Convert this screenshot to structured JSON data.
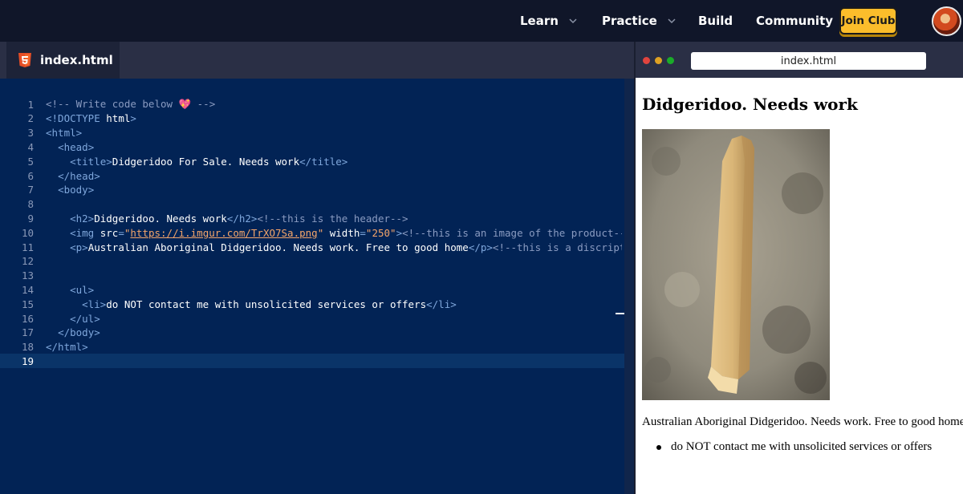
{
  "nav": {
    "items": [
      {
        "label": "Learn",
        "has_dropdown": true
      },
      {
        "label": "Practice",
        "has_dropdown": true
      },
      {
        "label": "Build",
        "has_dropdown": false
      },
      {
        "label": "Community",
        "has_dropdown": false
      }
    ],
    "join_label": "Join Club",
    "avatar_icon": "user-avatar"
  },
  "editor": {
    "tab": {
      "icon": "html5-icon",
      "label": "index.html"
    },
    "active_line": 19,
    "lines": [
      {
        "n": "1",
        "tokens": [
          [
            "cmt",
            "<!-- Write code below 💖 -->"
          ]
        ]
      },
      {
        "n": "2",
        "tokens": [
          [
            "tag",
            "<!DOCTYPE "
          ],
          [
            "txt",
            "html"
          ],
          [
            "tag",
            ">"
          ]
        ]
      },
      {
        "n": "3",
        "tokens": [
          [
            "tag",
            "<html>"
          ]
        ]
      },
      {
        "n": "4",
        "tokens": [
          [
            "txt",
            "  "
          ],
          [
            "tag",
            "<head>"
          ]
        ]
      },
      {
        "n": "5",
        "tokens": [
          [
            "txt",
            "    "
          ],
          [
            "tag",
            "<title>"
          ],
          [
            "txt",
            "Didgeridoo For Sale. Needs work"
          ],
          [
            "tag",
            "</title>"
          ]
        ]
      },
      {
        "n": "6",
        "tokens": [
          [
            "txt",
            "  "
          ],
          [
            "tag",
            "</head>"
          ]
        ]
      },
      {
        "n": "7",
        "tokens": [
          [
            "txt",
            "  "
          ],
          [
            "tag",
            "<body>"
          ]
        ]
      },
      {
        "n": "8",
        "tokens": [
          [
            "txt",
            ""
          ]
        ]
      },
      {
        "n": "9",
        "tokens": [
          [
            "txt",
            "    "
          ],
          [
            "tag",
            "<h2>"
          ],
          [
            "txt",
            "Didgeridoo. Needs work"
          ],
          [
            "tag",
            "</h2>"
          ],
          [
            "cmt",
            "<!--this is the header-->"
          ]
        ]
      },
      {
        "n": "10",
        "tokens": [
          [
            "txt",
            "    "
          ],
          [
            "tag",
            "<img "
          ],
          [
            "attr",
            "src"
          ],
          [
            "tag",
            "="
          ],
          [
            "strp",
            "\""
          ],
          [
            "str",
            "https://i.imgur.com/TrXO7Sa.png"
          ],
          [
            "strp",
            "\""
          ],
          [
            "txt",
            " "
          ],
          [
            "attr",
            "width"
          ],
          [
            "tag",
            "="
          ],
          [
            "strp",
            "\"250\""
          ],
          [
            "tag",
            ">"
          ],
          [
            "cmt",
            "<!--this is an image of the product-->"
          ]
        ]
      },
      {
        "n": "11",
        "tokens": [
          [
            "txt",
            "    "
          ],
          [
            "tag",
            "<p>"
          ],
          [
            "txt",
            "Australian Aboriginal Didgeridoo. Needs work. Free to good home"
          ],
          [
            "tag",
            "</p>"
          ],
          [
            "cmt",
            "<!--this is a discription"
          ]
        ]
      },
      {
        "n": "12",
        "tokens": [
          [
            "txt",
            ""
          ]
        ]
      },
      {
        "n": "13",
        "tokens": [
          [
            "txt",
            ""
          ]
        ]
      },
      {
        "n": "14",
        "tokens": [
          [
            "txt",
            "    "
          ],
          [
            "tag",
            "<ul>"
          ]
        ]
      },
      {
        "n": "15",
        "tokens": [
          [
            "txt",
            "      "
          ],
          [
            "tag",
            "<li>"
          ],
          [
            "txt",
            "do NOT contact me with unsolicited services or offers"
          ],
          [
            "tag",
            "</li>"
          ]
        ]
      },
      {
        "n": "16",
        "tokens": [
          [
            "txt",
            "    "
          ],
          [
            "tag",
            "</ul>"
          ]
        ]
      },
      {
        "n": "17",
        "tokens": [
          [
            "txt",
            "  "
          ],
          [
            "tag",
            "</body>"
          ]
        ]
      },
      {
        "n": "18",
        "tokens": [
          [
            "tag",
            "</html>"
          ]
        ]
      },
      {
        "n": "19",
        "tokens": [
          [
            "txt",
            ""
          ]
        ]
      }
    ]
  },
  "preview": {
    "url": "index.html",
    "heading": "Didgeridoo. Needs work",
    "image_alt": "wooden-stick-photo",
    "paragraph": "Australian Aboriginal Didgeridoo. Needs work. Free to good home",
    "list": [
      "do NOT contact me with unsolicited services or offers"
    ],
    "window_dots": [
      "#e0443e",
      "#dea123",
      "#1aab29"
    ]
  },
  "colors": {
    "nav_bg": "#101629",
    "editor_bg": "#022355",
    "join_bg": "#fbbd2b",
    "tag": "#7fa7dc",
    "string": "#f5a56a"
  }
}
